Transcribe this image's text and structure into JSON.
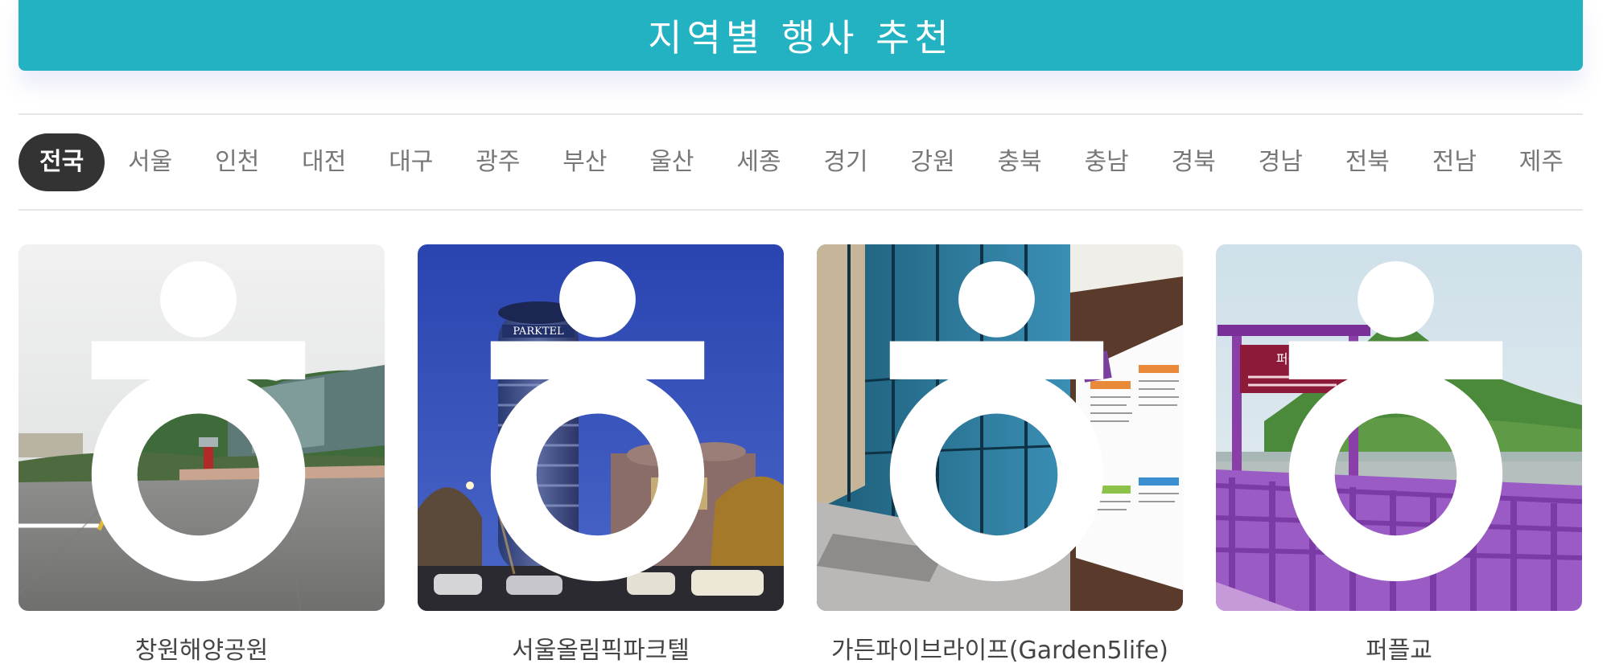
{
  "header": {
    "title": "지역별 행사 추천"
  },
  "regions": {
    "active": "전국",
    "items": [
      "전국",
      "서울",
      "인천",
      "대전",
      "대구",
      "광주",
      "부산",
      "울산",
      "세종",
      "경기",
      "강원",
      "충북",
      "충남",
      "경북",
      "경남",
      "전북",
      "전남",
      "제주"
    ]
  },
  "cards": [
    {
      "title": "창원해양공원",
      "image_icon": "plaza-photo",
      "badge_icon": "accessibility-icon"
    },
    {
      "title": "서울올림픽파크텔",
      "image_icon": "hotel-tower-night-photo",
      "badge_icon": "accessibility-icon",
      "sign_text": "PARKTEL"
    },
    {
      "title": "가든파이브라이프(Garden5life)",
      "image_icon": "glass-building-photo",
      "badge_icon": "accessibility-icon"
    },
    {
      "title": "퍼플교",
      "image_icon": "purple-bridge-photo",
      "badge_icon": "accessibility-icon",
      "sign_text": "퍼플교"
    }
  ],
  "colors": {
    "banner": "#22b2c1",
    "active_tab": "#333333",
    "purple_bridge": "#9b5bc4"
  }
}
